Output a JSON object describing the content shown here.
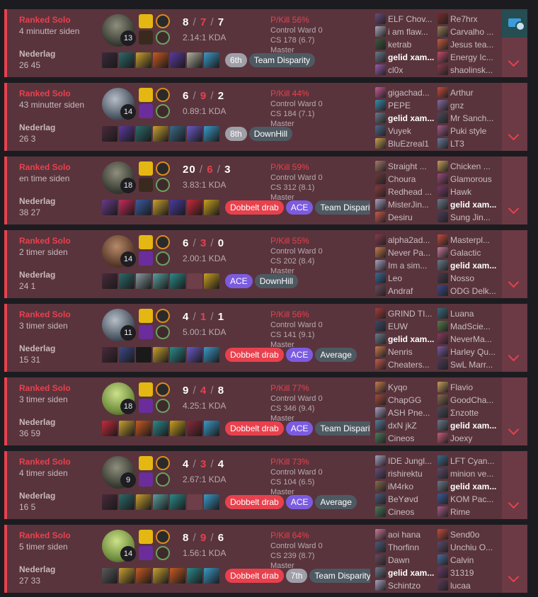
{
  "colors": {
    "loss": "#e8414d",
    "card_bg": "#59343d",
    "ace": "#7b5ce0",
    "double": "#e8414d",
    "tag": "#4e5a62"
  },
  "matches": [
    {
      "mode": "Ranked Solo",
      "time": "4 minutter siden",
      "result": "Nederlag",
      "duration": "26 45",
      "level": "13",
      "k": "8",
      "d": "7",
      "a": "7",
      "kda": "2.14:1 KDA",
      "pkill": "P/Kill 56%",
      "ward": "Control Ward 0",
      "cs": "CS 178 (6.7)",
      "tier": "Master",
      "champ": "dark",
      "spell2": "ign",
      "tags": [
        {
          "t": "6th",
          "c": "place"
        },
        {
          "t": "Team Disparity",
          "c": "gray"
        }
      ],
      "items": [
        "#3a2a3a",
        "#2c6a6a",
        "#c8a030",
        "#c85a20",
        "#5a3aa0",
        "#b0b0a0",
        "#3a9ac8"
      ],
      "team1": [
        {
          "n": "ELF Chov...",
          "c": "#6a4a7a"
        },
        {
          "n": "i am flaw...",
          "c": "#a8a8b8"
        },
        {
          "n": "ketrab",
          "c": "#3a5a3a"
        },
        {
          "n": "gelid xam...",
          "c": "#6a7a8a",
          "me": true
        },
        {
          "n": "cl0x",
          "c": "#9a5ab0"
        }
      ],
      "team2": [
        {
          "n": "Re7hrx",
          "c": "#7a2a2a"
        },
        {
          "n": "Carvalho ...",
          "c": "#9a7a5a"
        },
        {
          "n": "Jesus tea...",
          "c": "#c85a3a"
        },
        {
          "n": "Energy Ic...",
          "c": "#c84a6a"
        },
        {
          "n": "shaolinsk...",
          "c": "#8a3a4a"
        }
      ],
      "side_icon": true
    },
    {
      "mode": "Ranked Solo",
      "time": "43 minutter siden",
      "result": "Nederlag",
      "duration": "26 3",
      "level": "14",
      "k": "6",
      "d": "9",
      "a": "2",
      "kda": "0.89:1 KDA",
      "pkill": "P/Kill 44%",
      "ward": "Control Ward 0",
      "cs": "CS 184 (7.1)",
      "tier": "Master",
      "champ": "",
      "spell2": "",
      "tags": [
        {
          "t": "8th",
          "c": "place"
        },
        {
          "t": "DownHill",
          "c": "gray"
        }
      ],
      "items": [
        "#4a2a3a",
        "#5a3aa0",
        "#2c6a6a",
        "#c8a030",
        "#3a6a8a",
        "#6a5ac8",
        "#3a9ac8"
      ],
      "team1": [
        {
          "n": "gigachad...",
          "c": "#c85a9a"
        },
        {
          "n": "PEPE",
          "c": "#3a8ab0"
        },
        {
          "n": "gelid xam...",
          "c": "#6a7a8a",
          "me": true
        },
        {
          "n": "Vuyek",
          "c": "#4a6a8a"
        },
        {
          "n": "BluEzreal1",
          "c": "#c8a050"
        }
      ],
      "team2": [
        {
          "n": "Arthur",
          "c": "#c84a3a"
        },
        {
          "n": "gnz",
          "c": "#8a6aa0"
        },
        {
          "n": "Mr Sanch...",
          "c": "#4a4a5a"
        },
        {
          "n": "Puki style",
          "c": "#a85a8a"
        },
        {
          "n": "LT3",
          "c": "#6a7a9a"
        }
      ],
      "side_icon": false
    },
    {
      "mode": "Ranked Solo",
      "time": "en time siden",
      "result": "Nederlag",
      "duration": "38 27",
      "level": "18",
      "k": "20",
      "d": "6",
      "a": "3",
      "kda": "3.83:1 KDA",
      "pkill": "P/Kill 59%",
      "ward": "Control Ward 0",
      "cs": "CS 312 (8.1)",
      "tier": "Master",
      "champ": "dark",
      "spell2": "ign",
      "tags": [
        {
          "t": "Dobbelt drab",
          "c": "red"
        },
        {
          "t": "ACE",
          "c": "purple"
        },
        {
          "t": "Team Disparity",
          "c": "gray"
        }
      ],
      "items": [
        "#6a3a8a",
        "#c82a5a",
        "#3a5aa0",
        "#c8a030",
        "#4a3aa0",
        "#c82a3a",
        "#c8a020"
      ],
      "team1": [
        {
          "n": "Straight ...",
          "c": "#a87a6a"
        },
        {
          "n": "Choura",
          "c": "#6a3a3a"
        },
        {
          "n": "Redhead ...",
          "c": "#8a3a3a"
        },
        {
          "n": "MisterJin...",
          "c": "#a8a0c0"
        },
        {
          "n": "Desiru",
          "c": "#c85a4a"
        }
      ],
      "team2": [
        {
          "n": "Chicken ...",
          "c": "#c8a05a"
        },
        {
          "n": "Glamorous",
          "c": "#9a4a7a"
        },
        {
          "n": "Hawk",
          "c": "#7a3a6a"
        },
        {
          "n": "gelid xam...",
          "c": "#6a7a8a",
          "me": true
        },
        {
          "n": "Sung Jin...",
          "c": "#4a3a5a"
        }
      ],
      "side_icon": false
    },
    {
      "mode": "Ranked Solo",
      "time": "2 timer siden",
      "result": "Nederlag",
      "duration": "24 1",
      "level": "14",
      "k": "6",
      "d": "3",
      "a": "0",
      "kda": "2.00:1 KDA",
      "pkill": "P/Kill 55%",
      "ward": "Control Ward 0",
      "cs": "CS 202 (8.4)",
      "tier": "Master",
      "champ": "brown",
      "spell2": "",
      "tags": [
        {
          "t": "ACE",
          "c": "purple"
        },
        {
          "t": "DownHill",
          "c": "gray"
        }
      ],
      "items": [
        "#4a2a3a",
        "#2c6a6a",
        "#8a9aa0",
        "#5aa0a0",
        "#2c8a8a",
        "empty",
        "#c8a020"
      ],
      "team1": [
        {
          "n": "alpha2ad...",
          "c": "#8a3a4a"
        },
        {
          "n": "Never Pa...",
          "c": "#c87a4a"
        },
        {
          "n": "Im a sim...",
          "c": "#a8a0c0"
        },
        {
          "n": "Leo",
          "c": "#3a6a9a"
        },
        {
          "n": "Andraf",
          "c": "#6a4a5a"
        }
      ],
      "team2": [
        {
          "n": "Masterpl...",
          "c": "#c84a3a"
        },
        {
          "n": "Galactic",
          "c": "#c87a9a"
        },
        {
          "n": "gelid xam...",
          "c": "#6a7a8a",
          "me": true
        },
        {
          "n": "Nosso",
          "c": "#4a3a4a"
        },
        {
          "n": "ODG Delk...",
          "c": "#3a4a8a"
        }
      ],
      "side_icon": false
    },
    {
      "mode": "Ranked Solo",
      "time": "3 timer siden",
      "result": "Nederlag",
      "duration": "15 31",
      "level": "11",
      "k": "4",
      "d": "1",
      "a": "1",
      "kda": "5.00:1 KDA",
      "pkill": "P/Kill 56%",
      "ward": "Control Ward 0",
      "cs": "CS 141 (9.1)",
      "tier": "Master",
      "champ": "",
      "spell2": "",
      "tags": [
        {
          "t": "Dobbelt drab",
          "c": "red"
        },
        {
          "t": "ACE",
          "c": "purple"
        },
        {
          "t": "Average",
          "c": "gray"
        }
      ],
      "items": [
        "#4a2a3a",
        "#3a4a8a",
        "#1a1a1a",
        "#c8a030",
        "#2c8a8a",
        "#6a5ac8",
        "#3a9ac8"
      ],
      "team1": [
        {
          "n": "GRIND TI...",
          "c": "#a83a3a"
        },
        {
          "n": "EUW",
          "c": "#3a4a6a"
        },
        {
          "n": "gelid xam...",
          "c": "#6a7a8a",
          "me": true
        },
        {
          "n": "Nenris",
          "c": "#c87a4a"
        },
        {
          "n": "Cheaters...",
          "c": "#c85a4a"
        }
      ],
      "team2": [
        {
          "n": "Luana",
          "c": "#3a6a7a"
        },
        {
          "n": "MadScie...",
          "c": "#5a7a4a"
        },
        {
          "n": "NeverMa...",
          "c": "#8a3a5a"
        },
        {
          "n": "Harley Qu...",
          "c": "#7a5aa0"
        },
        {
          "n": "SwL Marr...",
          "c": "#4a3a5a"
        }
      ],
      "side_icon": false
    },
    {
      "mode": "Ranked Solo",
      "time": "3 timer siden",
      "result": "Nederlag",
      "duration": "36 59",
      "level": "18",
      "k": "9",
      "d": "4",
      "a": "8",
      "kda": "4.25:1 KDA",
      "pkill": "P/Kill 77%",
      "ward": "Control Ward 0",
      "cs": "CS 346 (9.4)",
      "tier": "Master",
      "champ": "green",
      "spell2": "tp",
      "tags": [
        {
          "t": "Dobbelt drab",
          "c": "red"
        },
        {
          "t": "ACE",
          "c": "purple"
        },
        {
          "t": "Team Disparity",
          "c": "gray"
        }
      ],
      "items": [
        "#c82a3a",
        "#c8a030",
        "#c85a20",
        "#2c8a8a",
        "#c8a020",
        "#8a2a3a",
        "#3a9ac8"
      ],
      "team1": [
        {
          "n": "Kyqo",
          "c": "#c87a4a"
        },
        {
          "n": "ChapGG",
          "c": "#a84a3a"
        },
        {
          "n": "ASH Pne...",
          "c": "#a8a0c0"
        },
        {
          "n": "dxN jkZ",
          "c": "#5a7a9a"
        },
        {
          "n": "Cineos",
          "c": "#4a7a5a"
        }
      ],
      "team2": [
        {
          "n": "Flavio",
          "c": "#c8a05a"
        },
        {
          "n": "GoodCha...",
          "c": "#8a6a4a"
        },
        {
          "n": "Σnzotte",
          "c": "#4a4a5a"
        },
        {
          "n": "gelid xam...",
          "c": "#6a7a8a",
          "me": true
        },
        {
          "n": "Joexy",
          "c": "#c85a7a"
        }
      ],
      "side_icon": false
    },
    {
      "mode": "Ranked Solo",
      "time": "4 timer siden",
      "result": "Nederlag",
      "duration": "16 5",
      "level": "9",
      "k": "4",
      "d": "3",
      "a": "4",
      "kda": "2.67:1 KDA",
      "pkill": "P/Kill 73%",
      "ward": "Control Ward 0",
      "cs": "CS 104 (6.5)",
      "tier": "Master",
      "champ": "dark",
      "spell2": "tp",
      "tags": [
        {
          "t": "Dobbelt drab",
          "c": "red"
        },
        {
          "t": "ACE",
          "c": "purple"
        },
        {
          "t": "Average",
          "c": "gray"
        }
      ],
      "items": [
        "#4a2a3a",
        "#2c6a6a",
        "#c8a030",
        "#5aa0a0",
        "#2c8a8a",
        "empty",
        "#3a9ac8"
      ],
      "team1": [
        {
          "n": "IDE Jungl...",
          "c": "#a8a0c0"
        },
        {
          "n": "rishirektu",
          "c": "#6a4a7a"
        },
        {
          "n": "iM4rko",
          "c": "#8a6a4a"
        },
        {
          "n": "BeYøvd",
          "c": "#4a5a7a"
        },
        {
          "n": "Cineos",
          "c": "#4a7a5a"
        }
      ],
      "team2": [
        {
          "n": "LFT Cyan...",
          "c": "#3a6a8a"
        },
        {
          "n": "minion ve...",
          "c": "#5a4a6a"
        },
        {
          "n": "gelid xam...",
          "c": "#6a7a8a",
          "me": true
        },
        {
          "n": "KOM Pac...",
          "c": "#3a5a9a"
        },
        {
          "n": "Rime",
          "c": "#a85a8a"
        }
      ],
      "side_icon": false
    },
    {
      "mode": "Ranked Solo",
      "time": "5 timer siden",
      "result": "Nederlag",
      "duration": "27 33",
      "level": "14",
      "k": "8",
      "d": "9",
      "a": "6",
      "kda": "1.56:1 KDA",
      "pkill": "P/Kill 64%",
      "ward": "Control Ward 0",
      "cs": "CS 239 (8.7)",
      "tier": "Master",
      "champ": "green",
      "spell2": "tp",
      "tags": [
        {
          "t": "Dobbelt drab",
          "c": "red"
        },
        {
          "t": "7th",
          "c": "place"
        },
        {
          "t": "Team Disparity",
          "c": "gray"
        }
      ],
      "items": [
        "#5a5a5a",
        "#c8a030",
        "#c85a20",
        "#c8a030",
        "#c85a20",
        "#2c8a8a",
        "#3a9ac8"
      ],
      "team1": [
        {
          "n": "aoi hana",
          "c": "#c87a9a"
        },
        {
          "n": "Thorfinn",
          "c": "#4a5a7a"
        },
        {
          "n": "Dawn",
          "c": "#6a4a5a"
        },
        {
          "n": "gelid xam...",
          "c": "#6a7a8a",
          "me": true
        },
        {
          "n": "Schintzo",
          "c": "#a8a0c0"
        }
      ],
      "team2": [
        {
          "n": "Send0o",
          "c": "#c84a3a"
        },
        {
          "n": "Unchiu O...",
          "c": "#5a4a6a"
        },
        {
          "n": "Calvin",
          "c": "#4a6a9a"
        },
        {
          "n": "31319",
          "c": "#6a3a6a"
        },
        {
          "n": "lucaa",
          "c": "#5a3a5a"
        }
      ],
      "side_icon": false
    }
  ]
}
